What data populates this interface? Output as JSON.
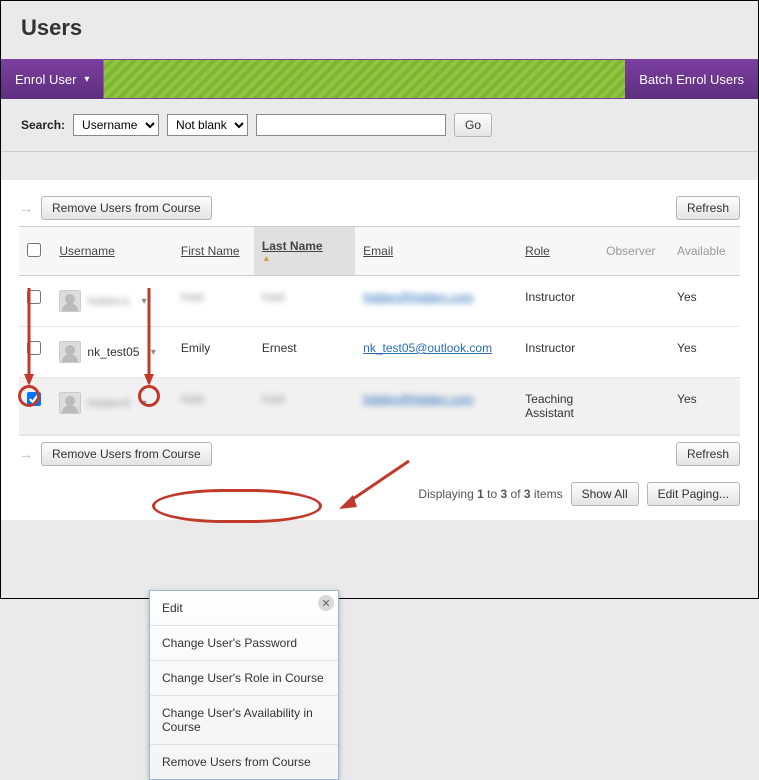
{
  "page_title": "Users",
  "toolbar": {
    "enrol_label": "Enrol User",
    "batch_label": "Batch Enrol Users"
  },
  "search": {
    "label": "Search:",
    "field_options": [
      "Username"
    ],
    "field_selected": "Username",
    "cond_options": [
      "Not blank"
    ],
    "cond_selected": "Not blank",
    "text_value": "",
    "go_label": "Go"
  },
  "buttons": {
    "remove_users": "Remove Users from Course",
    "refresh": "Refresh",
    "show_all": "Show All",
    "edit_paging": "Edit Paging..."
  },
  "columns": {
    "username": "Username",
    "first_name": "First Name",
    "last_name": "Last Name",
    "email": "Email",
    "role": "Role",
    "observer": "Observer",
    "available": "Available"
  },
  "rows": [
    {
      "checked": false,
      "username_hidden": true,
      "username": "hidden1",
      "first_name_hidden": true,
      "first_name": "hidd",
      "last_name_hidden": true,
      "last_name": "hidd",
      "email_hidden": true,
      "email": "hidden@hidden.com",
      "role": "Instructor",
      "observer": "",
      "available": "Yes"
    },
    {
      "checked": false,
      "username_hidden": false,
      "username": "nk_test05",
      "first_name_hidden": false,
      "first_name": "Emily",
      "last_name_hidden": false,
      "last_name": "Ernest",
      "email_hidden": false,
      "email": "nk_test05@outlook.com",
      "role": "Instructor",
      "observer": "",
      "available": "Yes"
    },
    {
      "checked": true,
      "username_hidden": true,
      "username": "hidden3",
      "first_name_hidden": true,
      "first_name": "hidd",
      "last_name_hidden": true,
      "last_name": "hidd",
      "email_hidden": true,
      "email": "hidden@hidden.com",
      "role": "Teaching Assistant",
      "observer": "",
      "available": "Yes"
    }
  ],
  "context_menu": {
    "items": [
      "Edit",
      "Change User's Password",
      "Change User's Role in Course",
      "Change User's Availability in Course",
      "Remove Users from Course"
    ]
  },
  "paging": {
    "prefix": "Displaying ",
    "from": "1",
    "mid1": " to ",
    "to": "3",
    "mid2": " of ",
    "total": "3",
    "suffix": " items"
  }
}
